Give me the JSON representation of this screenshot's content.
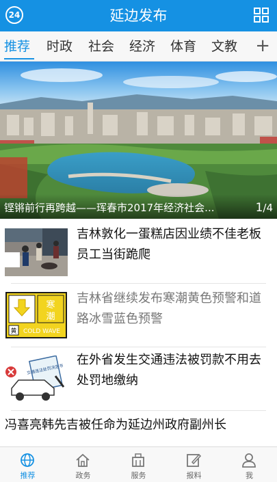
{
  "header": {
    "badge": "24",
    "title": "延边发布",
    "menu_icon": "grid-icon"
  },
  "tabs": {
    "items": [
      {
        "label": "推荐",
        "active": true
      },
      {
        "label": "时政",
        "active": false
      },
      {
        "label": "社会",
        "active": false
      },
      {
        "label": "经济",
        "active": false
      },
      {
        "label": "体育",
        "active": false
      },
      {
        "label": "文教",
        "active": false
      }
    ],
    "more": "+"
  },
  "banner": {
    "caption": "铿锵前行再跨越——珲春市2017年经济社会...",
    "page_current": "1",
    "page_sep": "/",
    "page_total": "4"
  },
  "news": [
    {
      "title": "吉林敦化一蛋糕店因业绩不佳老板员工当街跪爬",
      "read": false
    },
    {
      "title": "吉林省继续发布寒潮黄色预警和道路冰雪蓝色预警",
      "read": true,
      "thumb_text": {
        "top_left": "寒",
        "top_right": "潮",
        "bottom_left": "黄",
        "bottom_right": "COLD WAVE"
      }
    },
    {
      "title": "在外省发生交通违法被罚款不用去处罚地缴纳",
      "read": false,
      "thumb_text": {
        "doc": "交通违法处罚决定书"
      }
    },
    {
      "title": "冯喜亮韩先吉被任命为延边州政府副州长",
      "read": false
    }
  ],
  "bottom_nav": [
    {
      "label": "推荐",
      "icon": "globe-icon",
      "active": true
    },
    {
      "label": "政务",
      "icon": "house-icon",
      "active": false
    },
    {
      "label": "服务",
      "icon": "building-icon",
      "active": false
    },
    {
      "label": "报料",
      "icon": "edit-icon",
      "active": false
    },
    {
      "label": "我",
      "icon": "person-icon",
      "active": false
    }
  ],
  "colors": {
    "accent": "#1591e3",
    "text": "#111111",
    "read_text": "#777777"
  }
}
